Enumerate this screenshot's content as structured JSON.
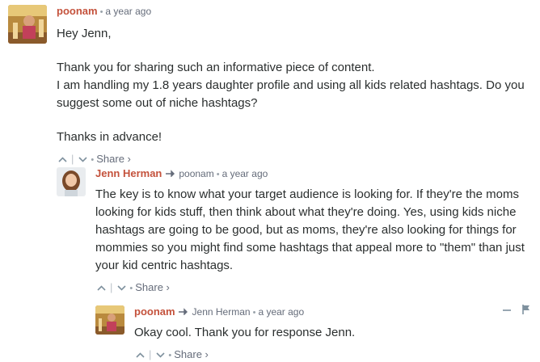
{
  "comments": [
    {
      "author": "poonam",
      "time": "a year ago",
      "paragraphs": [
        "Hey Jenn,",
        "Thank you for sharing such an informative piece of content.",
        "I am handling my 1.8 years daughter profile and using all kids related hashtags. Do you suggest some out of niche hashtags?",
        "Thanks in advance!"
      ],
      "share_label": "Share ›"
    },
    {
      "author": "Jenn Herman",
      "reply_to": "poonam",
      "time": "a year ago",
      "paragraphs": [
        "The key is to know what your target audience is looking for. If they're the moms looking for kids stuff, then think about what they're doing. Yes, using kids niche hashtags are going to be good, but as moms, they're also looking for things for mommies so you might find some hashtags that appeal more to \"them\" than just your kid centric hashtags."
      ],
      "share_label": "Share ›"
    },
    {
      "author": "poonam",
      "reply_to": "Jenn Herman",
      "time": "a year ago",
      "paragraphs": [
        "Okay cool. Thank you for response Jenn."
      ],
      "share_label": "Share ›"
    }
  ],
  "icons": {
    "upvote": "chevron-up-icon",
    "downvote": "chevron-down-icon",
    "reply_arrow": "reply-arrow-icon",
    "collapse": "minus-icon",
    "flag": "flag-icon"
  },
  "colors": {
    "author": "#c4523c",
    "meta": "#656c7a",
    "text": "#2a2e2e"
  }
}
